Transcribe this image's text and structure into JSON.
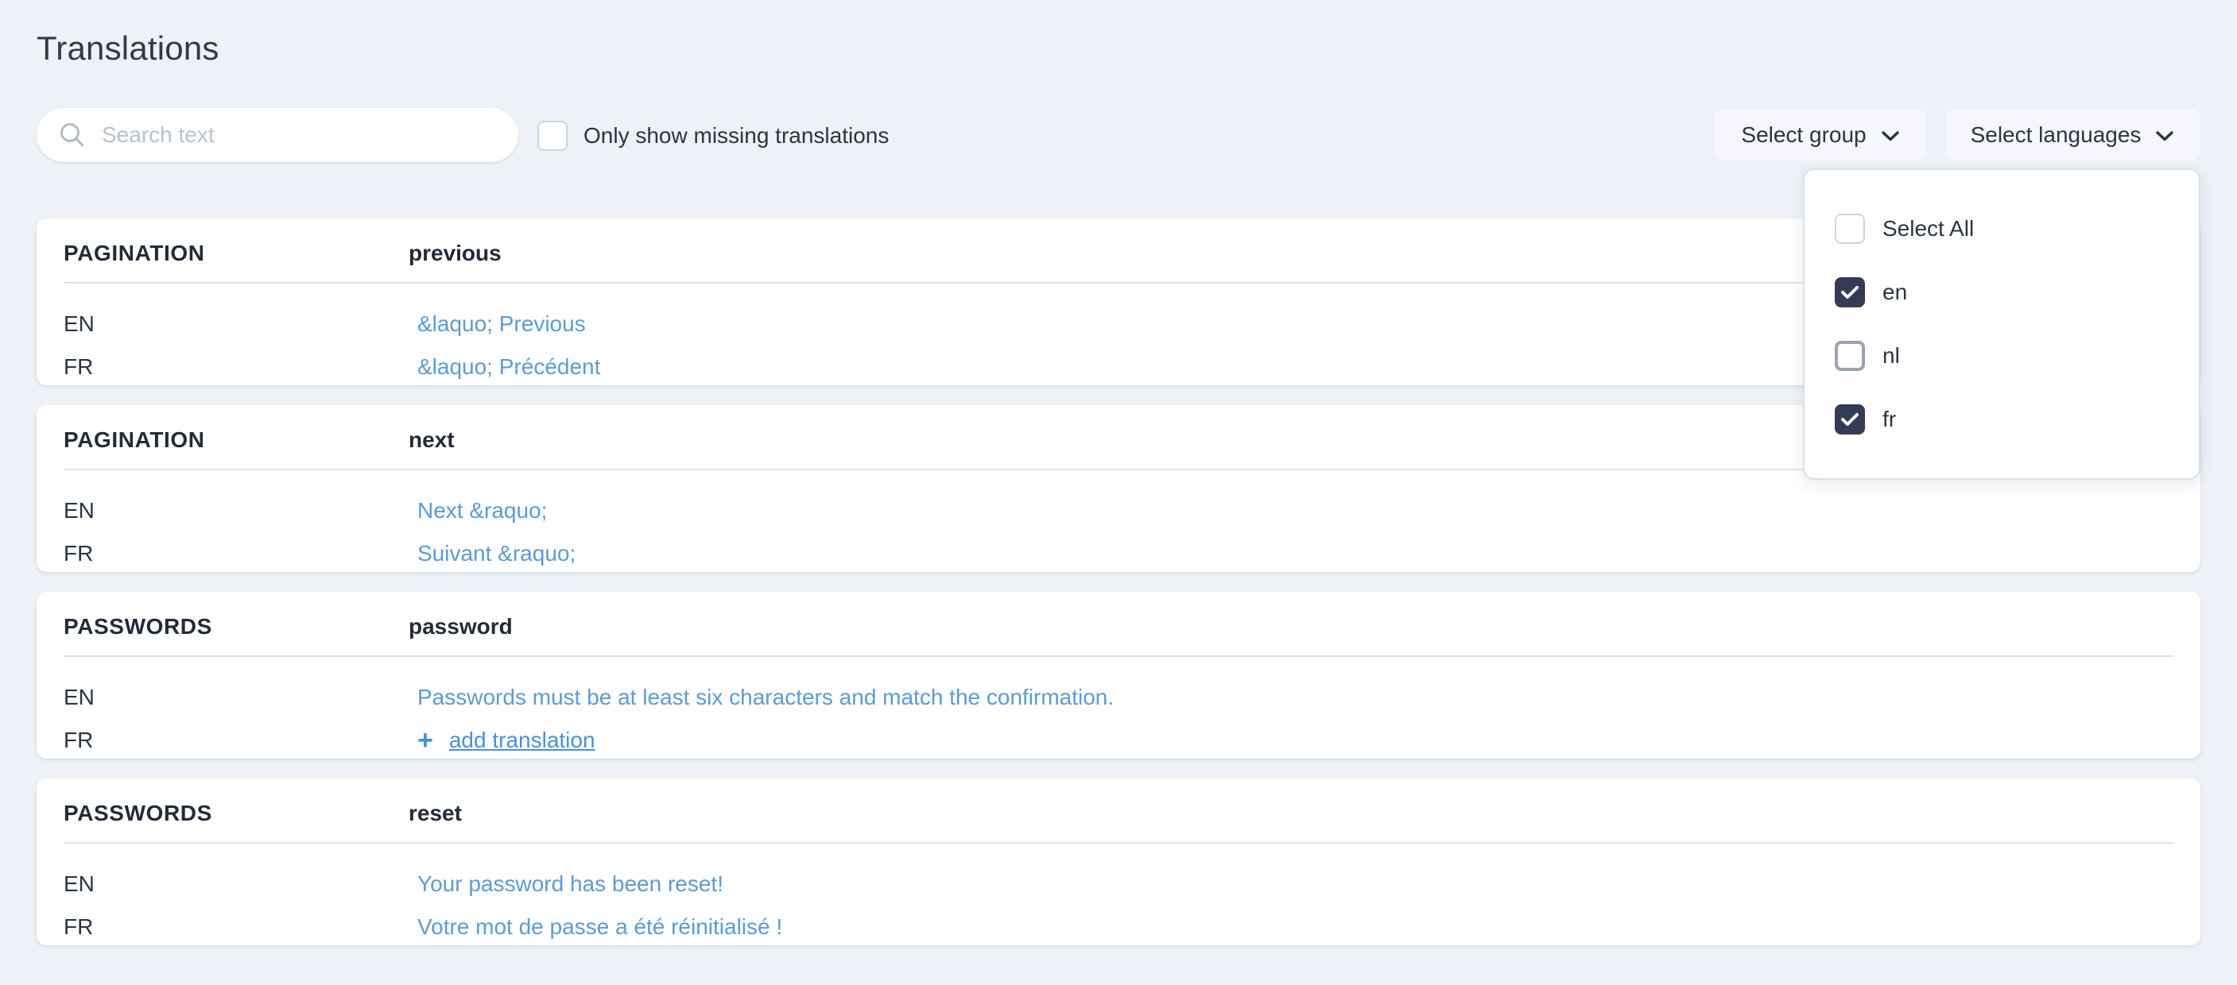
{
  "page": {
    "title": "Translations"
  },
  "toolbar": {
    "search": {
      "placeholder": "Search text",
      "value": "",
      "icon": "search-icon"
    },
    "missing_filter": {
      "label": "Only show missing translations",
      "checked": false
    },
    "select_group": {
      "label": "Select group",
      "icon": "chevron-down-icon"
    },
    "select_languages": {
      "label": "Select languages",
      "icon": "chevron-down-icon"
    }
  },
  "language_dropdown": {
    "open": true,
    "options": [
      {
        "label": "Select All",
        "checked": false,
        "state": "normal"
      },
      {
        "label": "en",
        "checked": true,
        "state": "normal"
      },
      {
        "label": "nl",
        "checked": false,
        "state": "hover"
      },
      {
        "label": "fr",
        "checked": true,
        "state": "normal"
      }
    ]
  },
  "colors": {
    "background": "#eef1f5",
    "card": "#ffffff",
    "text": "#2b3445",
    "link": "#5b9bd5",
    "accent": "#4a90d9",
    "checkbox_checked": "#343b54",
    "divider": "#dde3ea"
  },
  "cards": [
    {
      "group": "PAGINATION",
      "key": "previous",
      "rows": [
        {
          "lang": "EN",
          "value": "&laquo; Previous",
          "type": "text"
        },
        {
          "lang": "FR",
          "value": "&laquo; Précédent",
          "type": "text"
        }
      ]
    },
    {
      "group": "PAGINATION",
      "key": "next",
      "rows": [
        {
          "lang": "EN",
          "value": "Next &raquo;",
          "type": "text"
        },
        {
          "lang": "FR",
          "value": "Suivant &raquo;",
          "type": "text"
        }
      ]
    },
    {
      "group": "PASSWORDS",
      "key": "password",
      "rows": [
        {
          "lang": "EN",
          "value": "Passwords must be at least six characters and match the confirmation.",
          "type": "text"
        },
        {
          "lang": "FR",
          "value": "add translation",
          "type": "add"
        }
      ]
    },
    {
      "group": "PASSWORDS",
      "key": "reset",
      "rows": [
        {
          "lang": "EN",
          "value": "Your password has been reset!",
          "type": "text"
        },
        {
          "lang": "FR",
          "value": "Votre mot de passe a été réinitialisé !",
          "type": "text"
        }
      ]
    }
  ]
}
